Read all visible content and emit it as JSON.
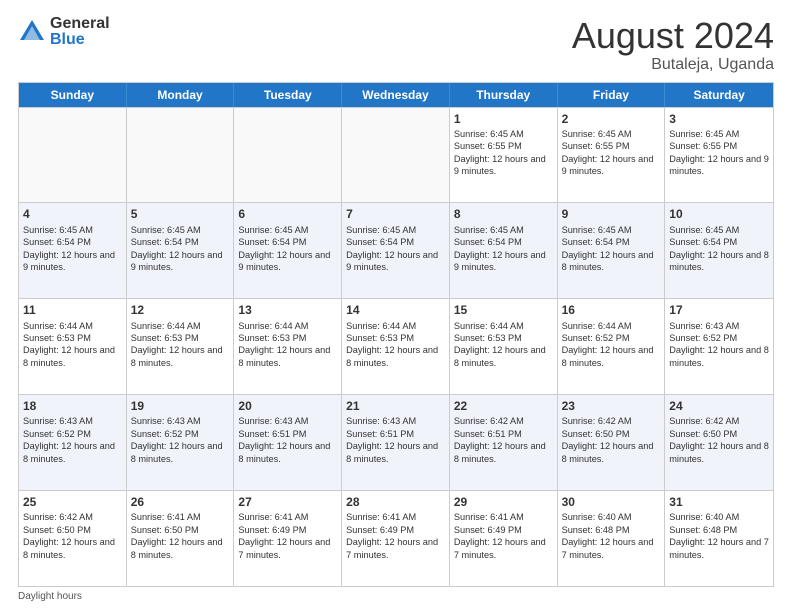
{
  "logo": {
    "general": "General",
    "blue": "Blue"
  },
  "title": "August 2024",
  "location": "Butaleja, Uganda",
  "days_of_week": [
    "Sunday",
    "Monday",
    "Tuesday",
    "Wednesday",
    "Thursday",
    "Friday",
    "Saturday"
  ],
  "weeks": [
    [
      {
        "day": "",
        "info": ""
      },
      {
        "day": "",
        "info": ""
      },
      {
        "day": "",
        "info": ""
      },
      {
        "day": "",
        "info": ""
      },
      {
        "day": "1",
        "info": "Sunrise: 6:45 AM\nSunset: 6:55 PM\nDaylight: 12 hours and 9 minutes."
      },
      {
        "day": "2",
        "info": "Sunrise: 6:45 AM\nSunset: 6:55 PM\nDaylight: 12 hours and 9 minutes."
      },
      {
        "day": "3",
        "info": "Sunrise: 6:45 AM\nSunset: 6:55 PM\nDaylight: 12 hours and 9 minutes."
      }
    ],
    [
      {
        "day": "4",
        "info": "Sunrise: 6:45 AM\nSunset: 6:54 PM\nDaylight: 12 hours and 9 minutes."
      },
      {
        "day": "5",
        "info": "Sunrise: 6:45 AM\nSunset: 6:54 PM\nDaylight: 12 hours and 9 minutes."
      },
      {
        "day": "6",
        "info": "Sunrise: 6:45 AM\nSunset: 6:54 PM\nDaylight: 12 hours and 9 minutes."
      },
      {
        "day": "7",
        "info": "Sunrise: 6:45 AM\nSunset: 6:54 PM\nDaylight: 12 hours and 9 minutes."
      },
      {
        "day": "8",
        "info": "Sunrise: 6:45 AM\nSunset: 6:54 PM\nDaylight: 12 hours and 9 minutes."
      },
      {
        "day": "9",
        "info": "Sunrise: 6:45 AM\nSunset: 6:54 PM\nDaylight: 12 hours and 8 minutes."
      },
      {
        "day": "10",
        "info": "Sunrise: 6:45 AM\nSunset: 6:54 PM\nDaylight: 12 hours and 8 minutes."
      }
    ],
    [
      {
        "day": "11",
        "info": "Sunrise: 6:44 AM\nSunset: 6:53 PM\nDaylight: 12 hours and 8 minutes."
      },
      {
        "day": "12",
        "info": "Sunrise: 6:44 AM\nSunset: 6:53 PM\nDaylight: 12 hours and 8 minutes."
      },
      {
        "day": "13",
        "info": "Sunrise: 6:44 AM\nSunset: 6:53 PM\nDaylight: 12 hours and 8 minutes."
      },
      {
        "day": "14",
        "info": "Sunrise: 6:44 AM\nSunset: 6:53 PM\nDaylight: 12 hours and 8 minutes."
      },
      {
        "day": "15",
        "info": "Sunrise: 6:44 AM\nSunset: 6:53 PM\nDaylight: 12 hours and 8 minutes."
      },
      {
        "day": "16",
        "info": "Sunrise: 6:44 AM\nSunset: 6:52 PM\nDaylight: 12 hours and 8 minutes."
      },
      {
        "day": "17",
        "info": "Sunrise: 6:43 AM\nSunset: 6:52 PM\nDaylight: 12 hours and 8 minutes."
      }
    ],
    [
      {
        "day": "18",
        "info": "Sunrise: 6:43 AM\nSunset: 6:52 PM\nDaylight: 12 hours and 8 minutes."
      },
      {
        "day": "19",
        "info": "Sunrise: 6:43 AM\nSunset: 6:52 PM\nDaylight: 12 hours and 8 minutes."
      },
      {
        "day": "20",
        "info": "Sunrise: 6:43 AM\nSunset: 6:51 PM\nDaylight: 12 hours and 8 minutes."
      },
      {
        "day": "21",
        "info": "Sunrise: 6:43 AM\nSunset: 6:51 PM\nDaylight: 12 hours and 8 minutes."
      },
      {
        "day": "22",
        "info": "Sunrise: 6:42 AM\nSunset: 6:51 PM\nDaylight: 12 hours and 8 minutes."
      },
      {
        "day": "23",
        "info": "Sunrise: 6:42 AM\nSunset: 6:50 PM\nDaylight: 12 hours and 8 minutes."
      },
      {
        "day": "24",
        "info": "Sunrise: 6:42 AM\nSunset: 6:50 PM\nDaylight: 12 hours and 8 minutes."
      }
    ],
    [
      {
        "day": "25",
        "info": "Sunrise: 6:42 AM\nSunset: 6:50 PM\nDaylight: 12 hours and 8 minutes."
      },
      {
        "day": "26",
        "info": "Sunrise: 6:41 AM\nSunset: 6:50 PM\nDaylight: 12 hours and 8 minutes."
      },
      {
        "day": "27",
        "info": "Sunrise: 6:41 AM\nSunset: 6:49 PM\nDaylight: 12 hours and 7 minutes."
      },
      {
        "day": "28",
        "info": "Sunrise: 6:41 AM\nSunset: 6:49 PM\nDaylight: 12 hours and 7 minutes."
      },
      {
        "day": "29",
        "info": "Sunrise: 6:41 AM\nSunset: 6:49 PM\nDaylight: 12 hours and 7 minutes."
      },
      {
        "day": "30",
        "info": "Sunrise: 6:40 AM\nSunset: 6:48 PM\nDaylight: 12 hours and 7 minutes."
      },
      {
        "day": "31",
        "info": "Sunrise: 6:40 AM\nSunset: 6:48 PM\nDaylight: 12 hours and 7 minutes."
      }
    ]
  ],
  "footer": "Daylight hours"
}
